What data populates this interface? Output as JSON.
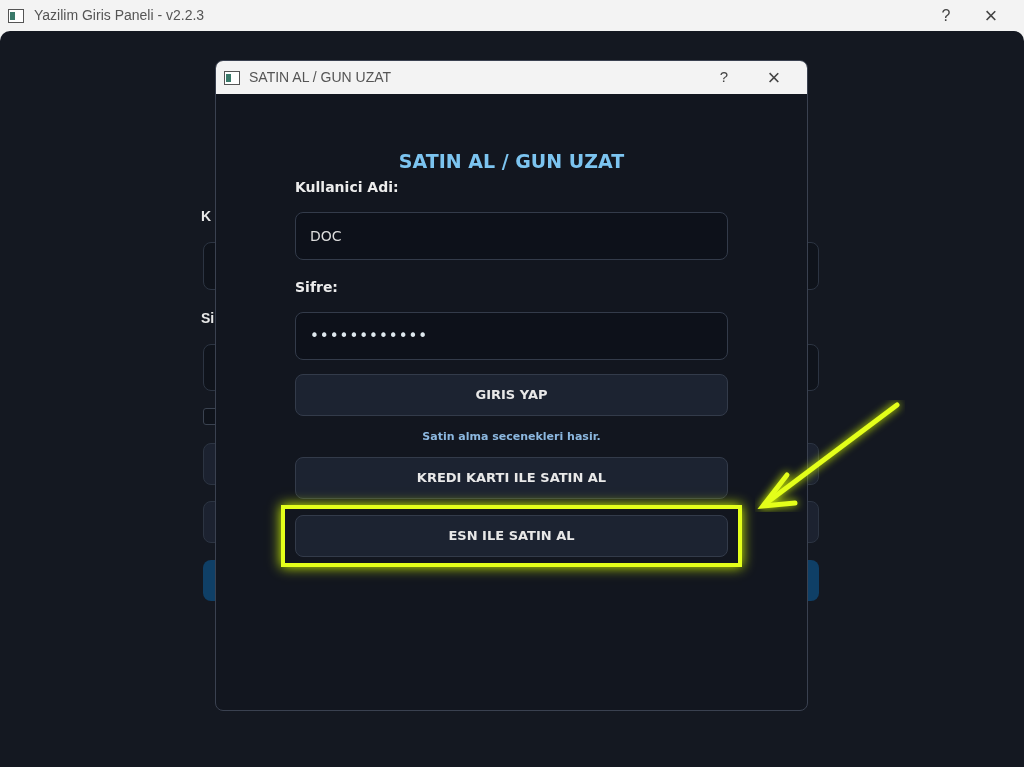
{
  "window": {
    "title": "Yazilim Giris Paneli - v2.2.3",
    "help": "?",
    "close": "×"
  },
  "background_form": {
    "labels": [
      "K",
      "Si"
    ],
    "remember_checkbox": {
      "checked": false
    }
  },
  "dialog": {
    "title": "SATIN AL / GUN UZAT",
    "help": "?",
    "close": "×",
    "heading": "SATIN AL / GUN UZAT",
    "fields": [
      {
        "label": "Kullanici Adi:",
        "kind": "text",
        "value": "DOC"
      },
      {
        "label": "Sifre:",
        "kind": "password",
        "value": "••••••••••••"
      }
    ],
    "login_button": "GIRIS YAP",
    "status": "Satin alma secenekleri hasir.",
    "buttons": [
      {
        "label": "KREDI KARTI ILE SATIN AL",
        "highlighted": false
      },
      {
        "label": "ESN ILE SATIN AL",
        "highlighted": true
      }
    ]
  }
}
